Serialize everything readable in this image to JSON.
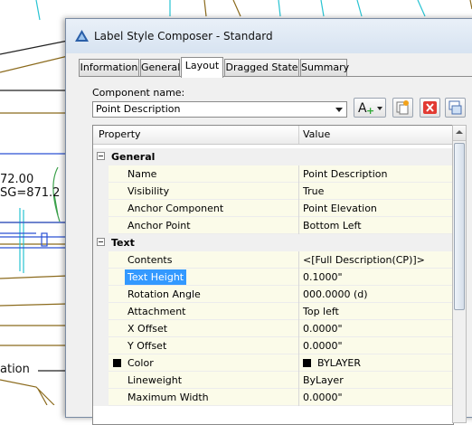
{
  "background": {
    "text_a": "72.00",
    "text_b": "SG=871.2",
    "text_c": "ation"
  },
  "window": {
    "title": "Label Style Composer - Standard",
    "icon": "civil3d-icon"
  },
  "tabs": [
    {
      "label": "Information",
      "active": false
    },
    {
      "label": "General",
      "active": false
    },
    {
      "label": "Layout",
      "active": true
    },
    {
      "label": "Dragged State",
      "active": false
    },
    {
      "label": "Summary",
      "active": false
    }
  ],
  "component": {
    "label": "Component name:",
    "selected": "Point Description",
    "buttons": [
      "add-component-icon",
      "copy-component-icon",
      "delete-component-icon",
      "draw-order-icon"
    ]
  },
  "grid": {
    "col_property": "Property",
    "col_value": "Value",
    "sections": [
      {
        "name": "General",
        "rows": [
          {
            "name": "Name",
            "value": "Point Description"
          },
          {
            "name": "Visibility",
            "value": "True"
          },
          {
            "name": "Anchor Component",
            "value": "Point Elevation"
          },
          {
            "name": "Anchor Point",
            "value": "Bottom Left"
          }
        ]
      },
      {
        "name": "Text",
        "rows": [
          {
            "name": "Contents",
            "value": "<[Full Description(CP)]>"
          },
          {
            "name": "Text Height",
            "value": "0.1000\"",
            "selected": true
          },
          {
            "name": "Rotation Angle",
            "value": "000.0000 (d)"
          },
          {
            "name": "Attachment",
            "value": "Top left"
          },
          {
            "name": "X Offset",
            "value": "0.0000\""
          },
          {
            "name": "Y Offset",
            "value": "0.0000\""
          },
          {
            "name": "Color",
            "value": "BYLAYER",
            "swatch": "#000000"
          },
          {
            "name": "Lineweight",
            "value": "ByLayer"
          },
          {
            "name": "Maximum Width",
            "value": "0.0000\""
          }
        ]
      }
    ]
  },
  "colors": {
    "selection": "#3399ff",
    "cell_background": "#fbfbe9"
  }
}
